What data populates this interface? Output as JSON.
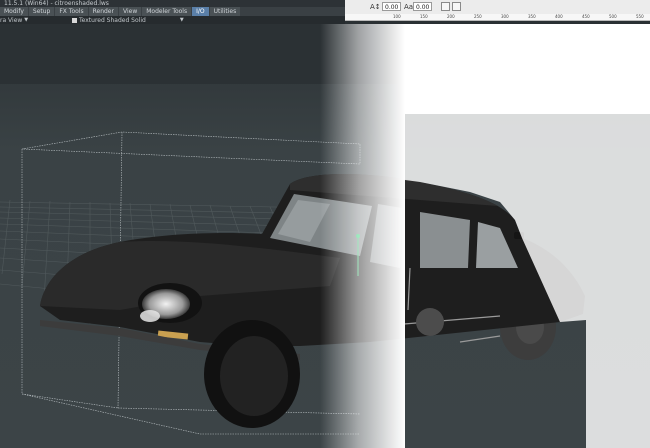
{
  "window": {
    "title": "11.5.1 (Win64) - citroenshaded.lws"
  },
  "menu": {
    "tabs": [
      {
        "label": "Modify"
      },
      {
        "label": "Setup"
      },
      {
        "label": "FX Tools"
      },
      {
        "label": "Render"
      },
      {
        "label": "View"
      },
      {
        "label": "Modeler Tools"
      },
      {
        "label": "I/O"
      },
      {
        "label": "Utilities"
      }
    ],
    "active_tab": "I/O"
  },
  "view_bar": {
    "view_type": "ra View",
    "render_mode": "Textured Shaded Solid"
  },
  "editor_toolbar": {
    "field_a_value": "0.00",
    "field_b_value": "0.00"
  },
  "ruler": {
    "labels": [
      "100",
      "150",
      "200",
      "250",
      "300",
      "350",
      "400",
      "450",
      "500",
      "550"
    ]
  },
  "colors": {
    "viewport_bg": "#2a3033",
    "menu_active": "#5a7fa8",
    "canvas_white": "#ffffff"
  }
}
